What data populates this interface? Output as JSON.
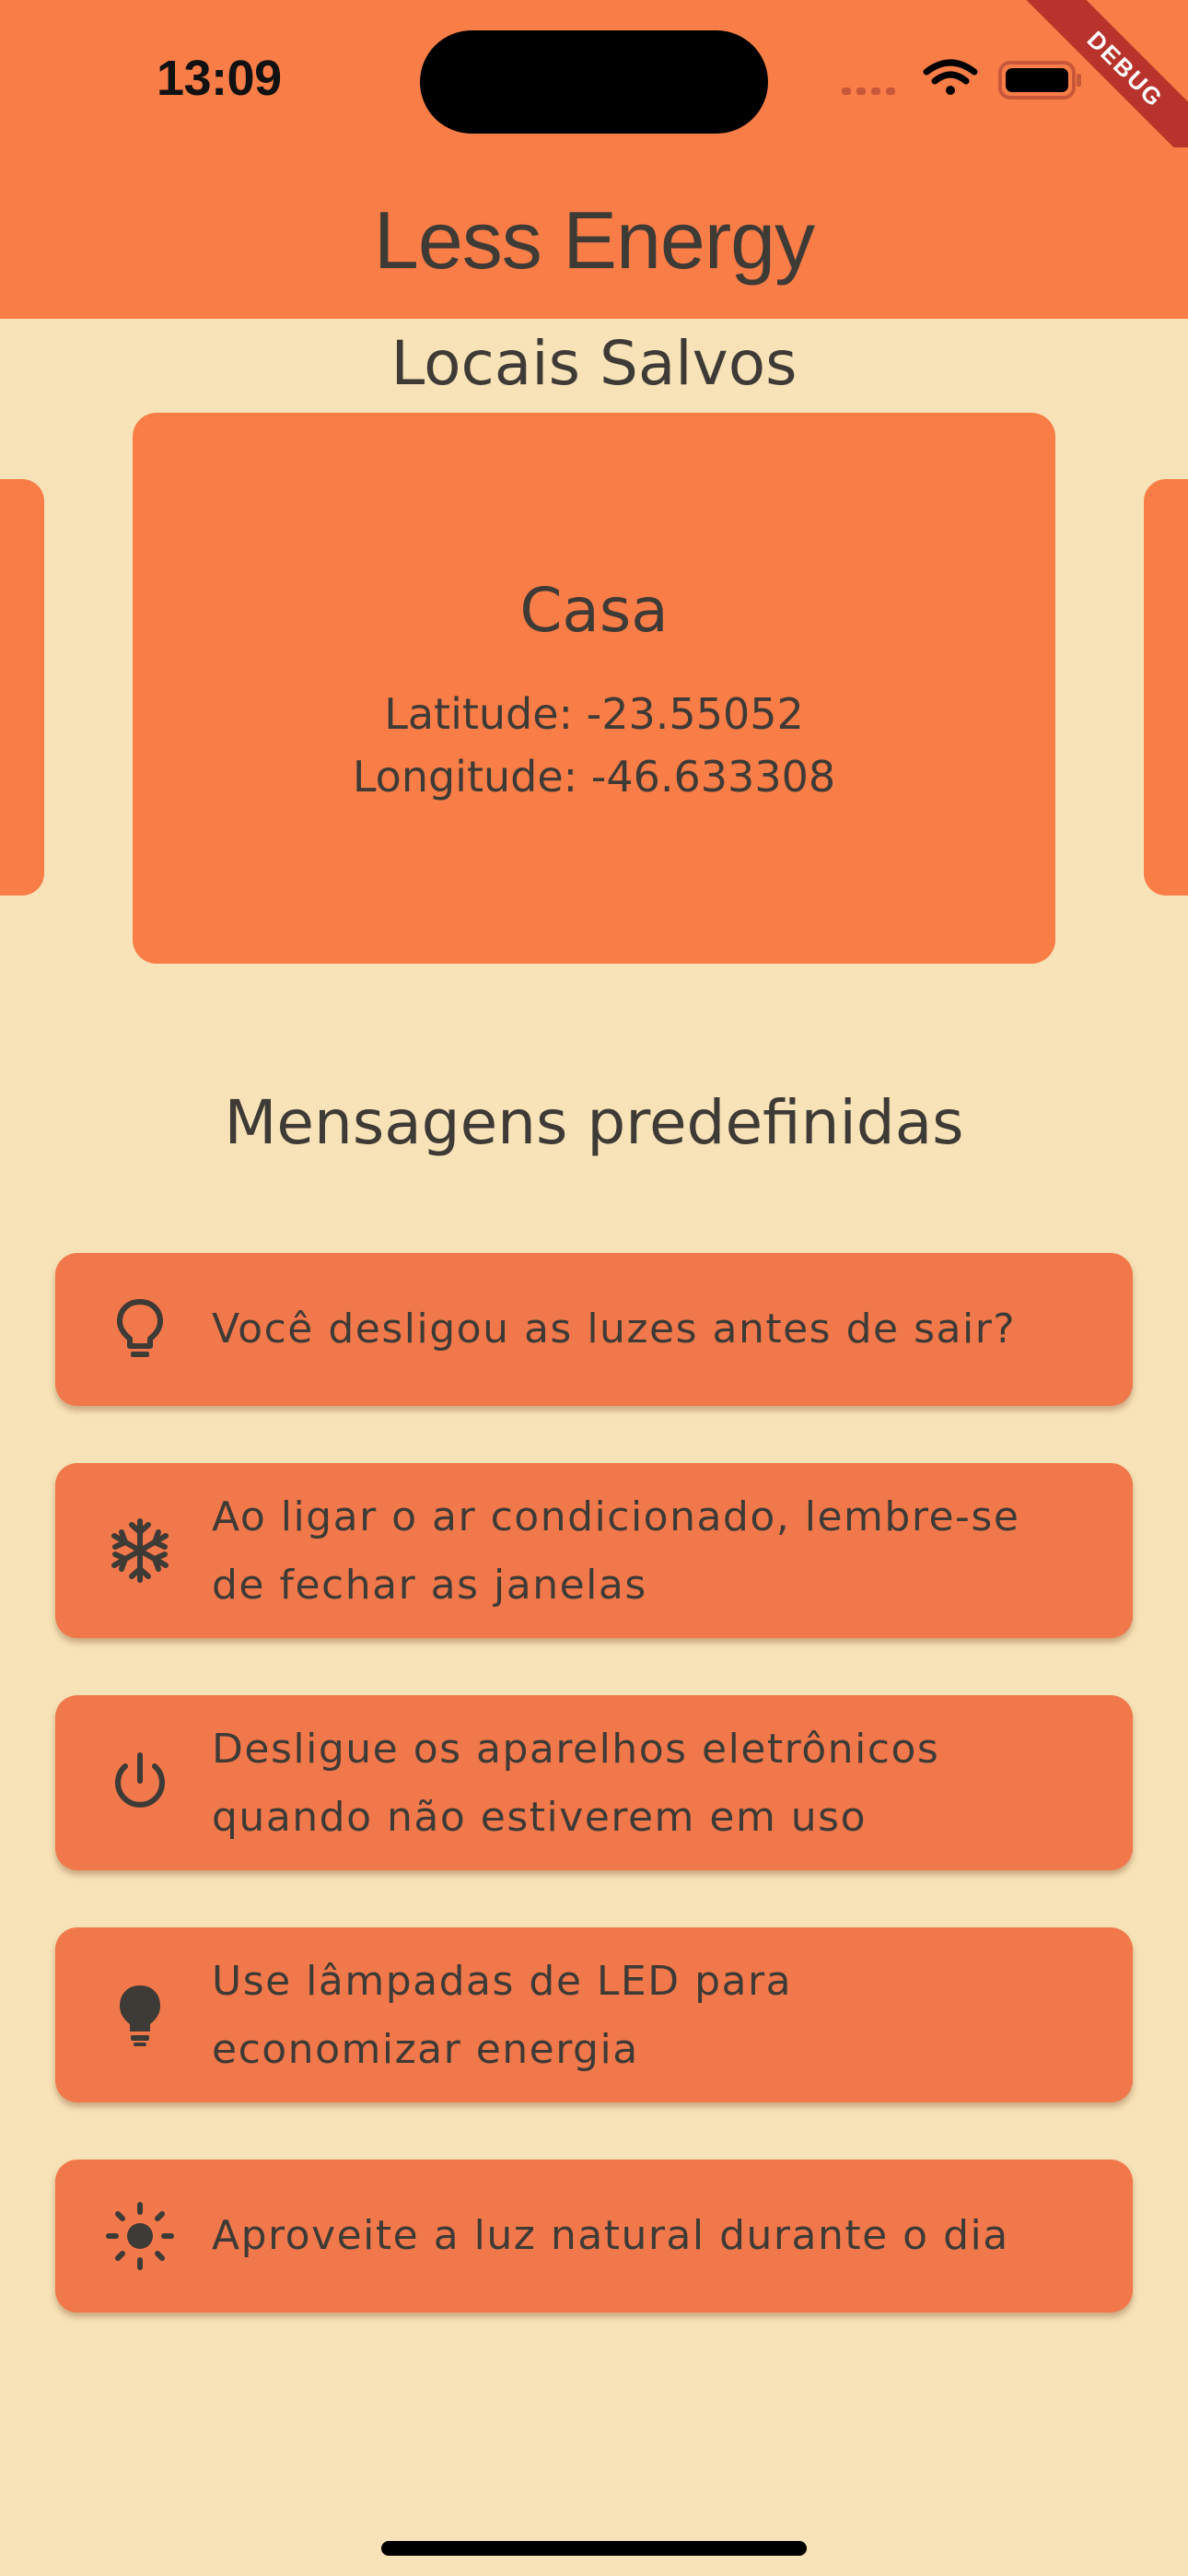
{
  "status_bar": {
    "time": "13:09",
    "icons": [
      "signal-dots-icon",
      "wifi-icon",
      "battery-icon"
    ],
    "debug_label": "DEBUG"
  },
  "app_bar": {
    "title": "Less Energy"
  },
  "saved_locations": {
    "title": "Locais Salvos",
    "current": {
      "name": "Casa",
      "latitude": "Latitude: -23.55052",
      "longitude": "Longitude: -46.633308"
    }
  },
  "messages": {
    "title": "Mensagens predefinidas",
    "items": [
      {
        "icon": "lightbulb-outline-icon",
        "text": "Você desligou as luzes antes de sair?"
      },
      {
        "icon": "snowflake-icon",
        "text_line1": "Ao ligar o ar condicionado, lembre-se",
        "text_line2": "de fechar as janelas"
      },
      {
        "icon": "power-icon",
        "text_line1": "Desligue os aparelhos eletrônicos",
        "text_line2": "quando não estiverem em uso"
      },
      {
        "icon": "lightbulb-filled-icon",
        "text_line1": "Use lâmpadas de LED para",
        "text_line2": "economizar energia"
      },
      {
        "icon": "sun-icon",
        "text": "Aproveite a luz natural durante o dia"
      }
    ]
  },
  "colors": {
    "primary": "#F97D47",
    "background": "#F7E3B7",
    "card": "#F1784A",
    "text": "#3E3A36"
  }
}
